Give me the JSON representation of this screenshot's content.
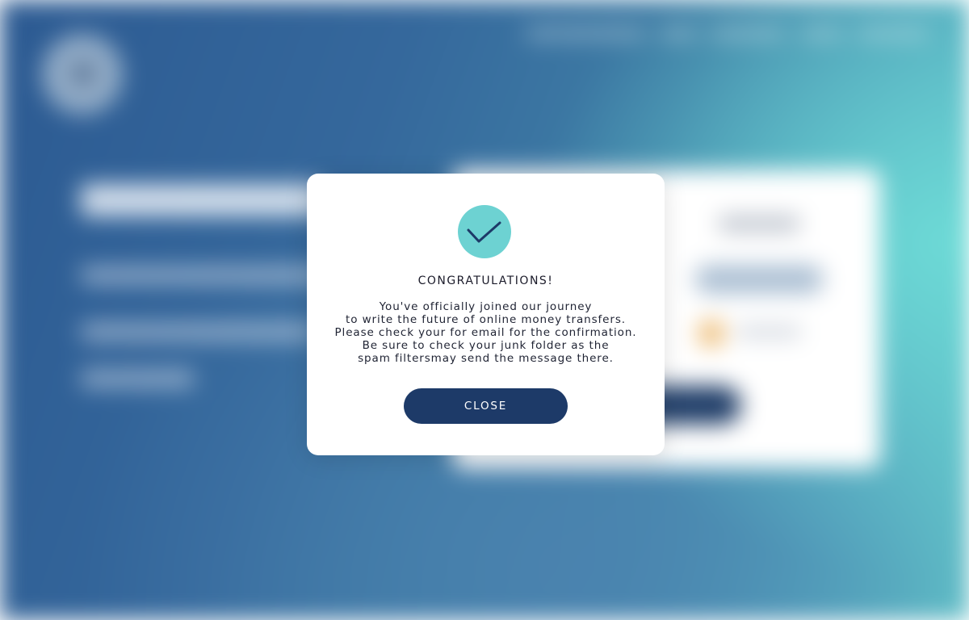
{
  "colors": {
    "accent": "#6dd2d2",
    "button": "#1d3a68",
    "modal_background": "#ffffff"
  },
  "modal": {
    "icon": "checkmark-icon",
    "title": "CONGRATULATIONS!",
    "message_lines": [
      "You've officially joined our journey",
      "to write the future of online money transfers.",
      "Please check your for email for the confirmation.",
      "Be sure to check your junk folder as the",
      "spam filtersmay send the message there."
    ],
    "close_label": "CLOSE"
  }
}
